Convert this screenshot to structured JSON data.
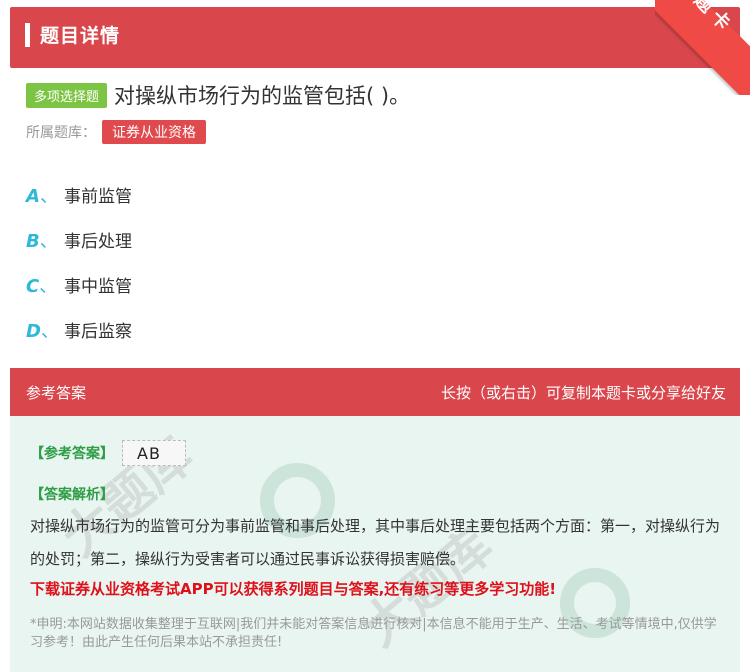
{
  "header": {
    "title": "题目详情",
    "corner_label": "题卡"
  },
  "question": {
    "type_badge": "多项选择题",
    "text": "对操纵市场行为的监管包括( )。",
    "bank_label": "所属题库：",
    "bank_tag": "证券从业资格"
  },
  "options": [
    {
      "letter": "A",
      "sep": "、",
      "text": "事前监管"
    },
    {
      "letter": "B",
      "sep": "、",
      "text": "事后处理"
    },
    {
      "letter": "C",
      "sep": "、",
      "text": "事中监管"
    },
    {
      "letter": "D",
      "sep": "、",
      "text": "事后监察"
    }
  ],
  "answer": {
    "header_title": "参考答案",
    "header_hint": "长按（或右击）可复制本题卡或分享给好友",
    "ref_label": "【参考答案】",
    "ref_value": "AB",
    "analysis_label": "【答案解析】",
    "analysis_text": "对操纵市场行为的监管可分为事前监管和事后处理，其中事后处理主要包括两个方面：第一，对操纵行为的处罚；第二，操纵行为受害者可以通过民事诉讼获得损害赔偿。",
    "promo": "下载证券从业资格考试APP可以获得系列题目与答案,还有练习等更多学习功能!",
    "disclaimer": "*申明:本网站数据收集整理于互联网|我们并未能对答案信息进行核对|本信息不能用于生产、生活、考试等情境中,仅供学习参考！由此产生任何后果本站不承担责任!"
  },
  "colors": {
    "header_red": "#d9474d",
    "badge_green": "#7cc444",
    "option_blue": "#30b8d8",
    "promo_red": "#e0101a"
  }
}
